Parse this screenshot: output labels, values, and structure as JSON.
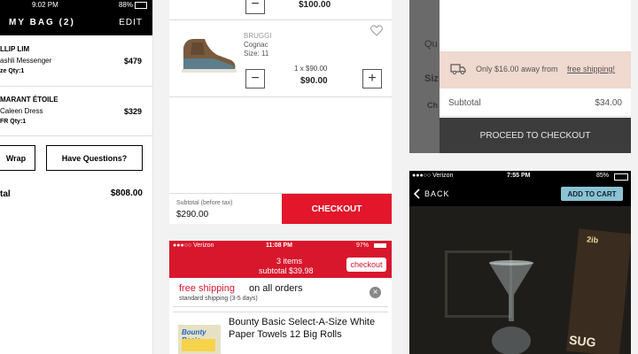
{
  "p1": {
    "time": "9:02 PM",
    "battery": "88%",
    "title": "MY BAG (2)",
    "edit": "EDIT",
    "item1": {
      "brand": "LLIP LIM",
      "name": "ashli Messenger",
      "meta": "ze   Qty:1",
      "price": "$479"
    },
    "item2": {
      "brand": "MARANT ÉTOILE",
      "name": "Caleen Dress",
      "meta": "FR   Qty:1",
      "price": "$329"
    },
    "wrap": "Wrap",
    "questions": "Have Questions?",
    "total_label": "tal",
    "total": "$808.00"
  },
  "p2": {
    "price_top": "$100.00",
    "brand": "BRUGGI",
    "color": "Cognac",
    "size": "Size: 11",
    "qty_line": "1 x $90.00",
    "line_total": "$90.00",
    "subtotal_label": "Subtotal (before tax)",
    "subtotal": "$290.00",
    "checkout": "CHECKOUT",
    "minus": "−",
    "plus": "+"
  },
  "p3": {
    "carrier": "●●●○○ Verizon",
    "time": "11:08 PM",
    "battery": "97%",
    "items": "3 items",
    "subtotal": "subtotal $39.98",
    "checkout": "checkout",
    "free": "free shipping",
    "on_all": "on all orders",
    "standard": "standard shipping (3-5 days)",
    "product": "Bounty Basic Select-A-Size White Paper Towels 12 Big Rolls",
    "brand_art": "Bounty Basic"
  },
  "p4": {
    "qu": "Qu",
    "siz": "Siz",
    "ch": "Ch",
    "shipping_prefix": "Only $16.00 away from",
    "shipping_link": "free shipping!",
    "subtotal_label": "Subtotal",
    "subtotal": "$34.00",
    "proceed": "PROCEED TO CHECKOUT"
  },
  "p5": {
    "carrier": "●●●○○ Verizon",
    "time": "7:55 PM",
    "battery": "85%",
    "back": "BACK",
    "add": "ADD TO CART",
    "art1": "2ib",
    "art2": "SUG"
  }
}
